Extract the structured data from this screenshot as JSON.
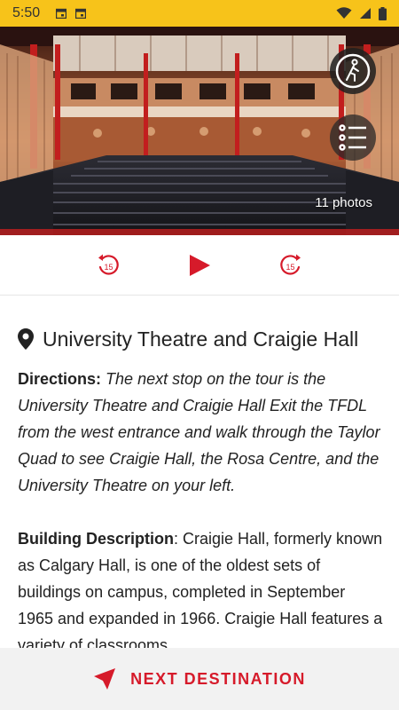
{
  "status_bar": {
    "time": "5:50",
    "left_icons": [
      "calendar-icon",
      "calendar-icon"
    ],
    "right_icons": [
      "wifi-icon",
      "cell-signal-icon",
      "battery-icon"
    ],
    "background": "#f7c31a"
  },
  "hero": {
    "image": "theatre-auditorium-photo",
    "photo_count": "11 photos"
  },
  "player": {
    "rewind_seconds": "15",
    "forward_seconds": "15",
    "accent": "#d61a2a"
  },
  "place": {
    "title": "University Theatre and Craigie Hall",
    "directions_label": "Directions:",
    "directions_text": "The next stop on the tour is the University Theatre and Craigie Hall Exit the TFDL from the west entrance and walk through the Taylor Quad to see Craigie Hall, the Rosa Centre, and the University Theatre on your left.",
    "description_label": "Building Description",
    "description_text": ": Craigie Hall, formerly known as Calgary Hall, is one of the oldest sets of buildings on campus, completed in September 1965 and expanded in 1966. Craigie Hall features a variety of classrooms"
  },
  "bottom": {
    "next_label": "NEXT DESTINATION"
  }
}
